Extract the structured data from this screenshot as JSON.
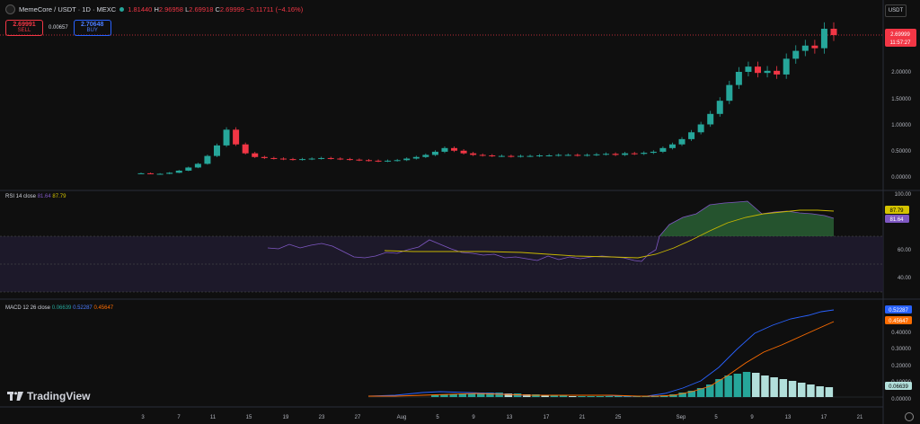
{
  "header": {
    "symbol": "MemeCore / USDT · 1D · MEXC",
    "ohlc": {
      "o_label": "",
      "o": "1.81440",
      "h_label": "H",
      "h": "2.96958",
      "l_label": "L",
      "l": "2.69918",
      "c_label": "C",
      "c": "2.69999",
      "change": "−0.11711 (−4.16%)"
    }
  },
  "trade": {
    "sell_price": "2.69991",
    "sell_label": "SELL",
    "spread": "0.00657",
    "buy_price": "2.70648",
    "buy_label": "BUY"
  },
  "currency": "USDT",
  "price_axis": {
    "ticks": [
      "2.00000",
      "1.50000",
      "1.00000",
      "0.50000",
      "0.00000"
    ],
    "last_price": "2.69999",
    "countdown": "11:57:27"
  },
  "rsi": {
    "label": "RSI 14 close",
    "v1": "81.64",
    "v2": "87.79",
    "ticks": [
      "100.00",
      "60.00",
      "40.00"
    ],
    "tag_ma": "87.79",
    "tag_rsi": "81.64"
  },
  "macd": {
    "label": "MACD 12 26 close",
    "hist": "0.06639",
    "macd": "0.52287",
    "signal": "0.45647",
    "ticks": [
      "0.40000",
      "0.30000",
      "0.20000",
      "0.10000",
      "0.00000"
    ],
    "tag_macd": "0.52287",
    "tag_signal": "0.45647",
    "tag_hist": "0.06639"
  },
  "time_axis": [
    "3",
    "7",
    "11",
    "15",
    "19",
    "23",
    "27",
    "Aug",
    "5",
    "9",
    "13",
    "17",
    "21",
    "25",
    "Sep",
    "5",
    "9",
    "13",
    "17",
    "21"
  ],
  "logo_text": "TradingView",
  "colors": {
    "up": "#26a69a",
    "down": "#f23645",
    "rsi": "#7e57c2",
    "ma": "#d4c300",
    "macd": "#2962ff",
    "signal": "#ff6d00"
  },
  "chart_data": {
    "type": "candlestick",
    "description_series": [
      {
        "name": "price",
        "values": [
          0.07,
          0.06,
          0.06,
          0.08,
          0.12,
          0.18,
          0.25,
          0.4,
          0.6,
          0.9,
          0.62,
          0.45,
          0.38,
          0.36,
          0.35,
          0.34,
          0.33,
          0.34,
          0.35,
          0.36,
          0.35,
          0.34,
          0.33,
          0.32,
          0.31,
          0.3,
          0.31,
          0.32,
          0.35,
          0.38,
          0.42,
          0.48,
          0.55,
          0.5,
          0.45,
          0.42,
          0.41,
          0.4,
          0.4,
          0.39,
          0.4,
          0.4,
          0.41,
          0.41,
          0.42,
          0.42,
          0.41,
          0.42,
          0.43,
          0.44,
          0.42,
          0.45,
          0.44,
          0.46,
          0.48,
          0.55,
          0.62,
          0.72,
          0.85,
          1.0,
          1.2,
          1.45,
          1.75,
          2.0,
          2.1,
          1.98,
          2.02,
          1.95,
          2.25,
          2.4,
          2.5,
          2.45,
          2.82,
          2.7
        ]
      }
    ]
  }
}
